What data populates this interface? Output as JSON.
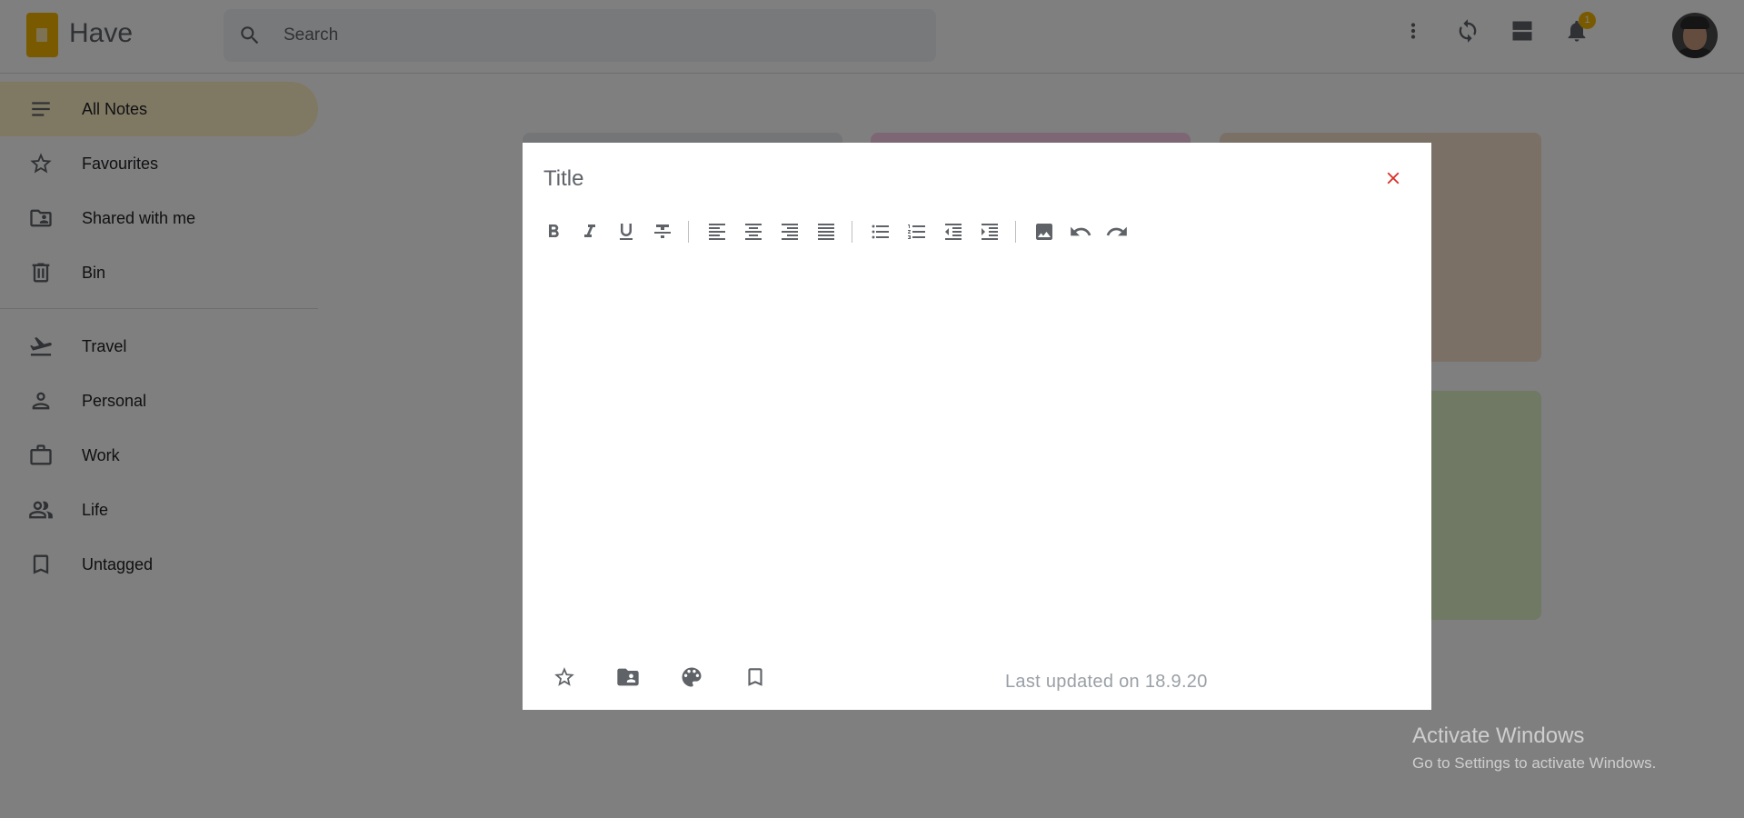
{
  "app": {
    "name": "Have"
  },
  "search": {
    "placeholder": "Search"
  },
  "header": {
    "notification_count": "1"
  },
  "sidebar": {
    "items": [
      {
        "label": "All Notes",
        "icon": "notes-list-icon",
        "active": true
      },
      {
        "label": "Favourites",
        "icon": "star-icon"
      },
      {
        "label": "Shared with me",
        "icon": "shared-folder-icon"
      },
      {
        "label": "Bin",
        "icon": "trash-icon"
      }
    ],
    "tags": [
      {
        "label": "Travel",
        "icon": "flight-icon"
      },
      {
        "label": "Personal",
        "icon": "person-icon"
      },
      {
        "label": "Work",
        "icon": "briefcase-icon"
      },
      {
        "label": "Life",
        "icon": "people-icon"
      },
      {
        "label": "Untagged",
        "icon": "bookmark-icon"
      }
    ]
  },
  "notes_background": {
    "card_colors": [
      "#e8eaed",
      "#fbcfe8",
      "#f5e1cd",
      "#dff2c6"
    ]
  },
  "editor": {
    "title_placeholder": "Title",
    "body": "",
    "toolbar": [
      "bold-icon",
      "italic-icon",
      "underline-icon",
      "strikethrough-icon",
      "align-left-icon",
      "align-center-icon",
      "align-right-icon",
      "align-justify-icon",
      "bullet-list-icon",
      "numbered-list-icon",
      "outdent-icon",
      "indent-icon",
      "image-icon",
      "undo-icon",
      "redo-icon"
    ],
    "footer_actions": [
      "star-icon",
      "shared-folder-icon",
      "palette-icon",
      "bookmark-icon"
    ],
    "last_updated": "Last updated on 18.9.20"
  },
  "watermark": {
    "title": "Activate Windows",
    "subtitle": "Go to Settings to activate Windows."
  },
  "colors": {
    "accent": "#f4b400",
    "active_nav": "#fef0c7",
    "close": "#d93025",
    "icon": "#5f6368"
  }
}
